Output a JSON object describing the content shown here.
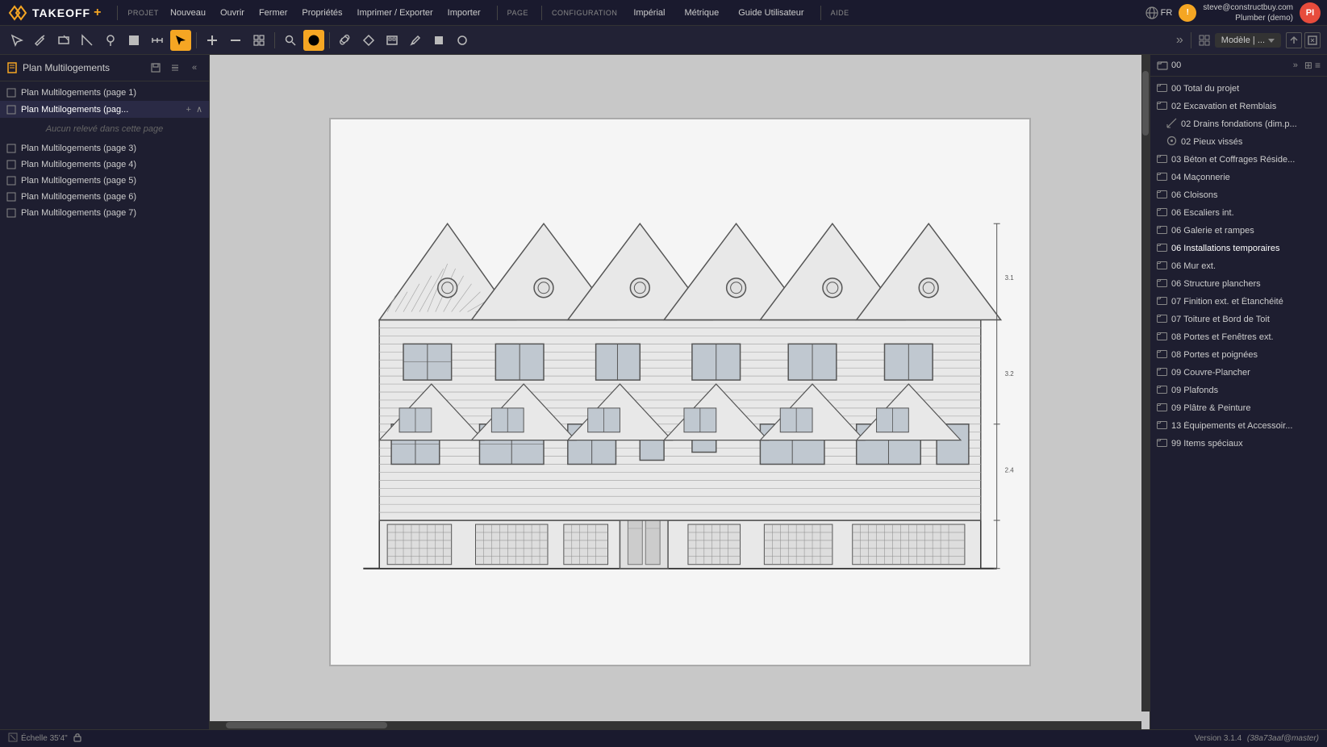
{
  "app": {
    "name": "TAKEOFF+",
    "logo_symbol": "◇◇"
  },
  "top_menu": {
    "projet_label": "PROJET",
    "page_label": "PAGE",
    "configuration_label": "CONFIGURATION",
    "aide_label": "AIDE",
    "items_projet": [
      "Nouveau",
      "Ouvrir",
      "Fermer",
      "Propriétés",
      "Imprimer / Exporter",
      "Importer"
    ],
    "items_configuration": [
      "Impérial",
      "Métrique",
      "Guide Utilisateur"
    ]
  },
  "user": {
    "email": "steve@constructbuy.com",
    "role": "Plumber (demo)",
    "avatar_initials": "PI",
    "lang": "FR"
  },
  "toolbar": {
    "tools": [
      {
        "name": "select-tool",
        "icon": "⬡",
        "active": false
      },
      {
        "name": "draw-tool",
        "icon": "✏",
        "active": false
      },
      {
        "name": "rectangle-tool",
        "icon": "⬜",
        "active": false
      },
      {
        "name": "angle-tool",
        "icon": "⌐",
        "active": false
      },
      {
        "name": "pin-tool",
        "icon": "◈",
        "active": false
      },
      {
        "name": "fill-tool",
        "icon": "■",
        "active": false
      },
      {
        "name": "measure-tool",
        "icon": "↕",
        "active": false
      },
      {
        "name": "cursor-tool",
        "icon": "↖",
        "active": false
      },
      {
        "name": "add-tool",
        "icon": "+",
        "active": false
      },
      {
        "name": "minus-tool",
        "icon": "−",
        "active": false
      },
      {
        "name": "grid-tool",
        "icon": "⊞",
        "active": false
      },
      {
        "name": "search-tool",
        "icon": "🔍",
        "active": false
      },
      {
        "name": "highlight-tool",
        "icon": "◉",
        "active": true
      },
      {
        "name": "link-tool",
        "icon": "⟡",
        "active": false
      },
      {
        "name": "diamond-tool",
        "icon": "◇",
        "active": false
      },
      {
        "name": "window-tool",
        "icon": "⊡",
        "active": false
      },
      {
        "name": "pen-tool",
        "icon": "✒",
        "active": false
      },
      {
        "name": "square-tool",
        "icon": "◼",
        "active": false
      },
      {
        "name": "circle-tool",
        "icon": "○",
        "active": false
      }
    ],
    "model_label": "Modèle | ..."
  },
  "left_sidebar": {
    "title": "Plan Multilogements",
    "pages": [
      {
        "label": "Plan Multilogements (page 1)",
        "active": false,
        "has_icon": true
      },
      {
        "label": "Plan Multilogements (pag...",
        "active": true,
        "has_icon": true,
        "empty_note": "Aucun relevé dans cette page"
      },
      {
        "label": "Plan Multilogements (page 3)",
        "active": false,
        "has_icon": true
      },
      {
        "label": "Plan Multilogements (page 4)",
        "active": false,
        "has_icon": true
      },
      {
        "label": "Plan Multilogements (page 5)",
        "active": false,
        "has_icon": true
      },
      {
        "label": "Plan Multilogements (page 6)",
        "active": false,
        "has_icon": true
      },
      {
        "label": "Plan Multilogements (page 7)",
        "active": false,
        "has_icon": true
      }
    ]
  },
  "status_bar": {
    "scale": "Échelle 35'4\"",
    "version": "Version 3.1.4",
    "build": "(38a73aaf@master)"
  },
  "right_sidebar": {
    "tree_items": [
      {
        "label": "00 Total du projet",
        "level": 0,
        "icon": "folder",
        "type": "folder"
      },
      {
        "label": "02 Excavation et Remblais",
        "level": 0,
        "icon": "folder",
        "type": "folder"
      },
      {
        "label": "02 Drains fondations (dim.p...",
        "level": 1,
        "icon": "measure",
        "type": "item"
      },
      {
        "label": "02 Pieux vissés",
        "level": 1,
        "icon": "circle",
        "type": "item"
      },
      {
        "label": "03 Béton et Coffrages Réside...",
        "level": 0,
        "icon": "folder",
        "type": "folder"
      },
      {
        "label": "04 Maçonnerie",
        "level": 0,
        "icon": "folder",
        "type": "folder"
      },
      {
        "label": "06 Cloisons",
        "level": 0,
        "icon": "folder",
        "type": "folder"
      },
      {
        "label": "06 Escaliers int.",
        "level": 0,
        "icon": "folder",
        "type": "folder"
      },
      {
        "label": "06 Galerie et rampes",
        "level": 0,
        "icon": "folder",
        "type": "folder"
      },
      {
        "label": "06 Installations temporaires",
        "level": 0,
        "icon": "folder",
        "type": "folder"
      },
      {
        "label": "06 Mur ext.",
        "level": 0,
        "icon": "folder",
        "type": "folder"
      },
      {
        "label": "06 Structure planchers",
        "level": 0,
        "icon": "folder",
        "type": "folder"
      },
      {
        "label": "07 Finition ext. et Étanchéité",
        "level": 0,
        "icon": "folder",
        "type": "folder"
      },
      {
        "label": "07 Toiture et Bord de Toit",
        "level": 0,
        "icon": "folder",
        "type": "folder"
      },
      {
        "label": "08 Portes et Fenêtres ext.",
        "level": 0,
        "icon": "folder",
        "type": "folder"
      },
      {
        "label": "08 Portes et poignées",
        "level": 0,
        "icon": "folder",
        "type": "folder"
      },
      {
        "label": "09 Couvre-Plancher",
        "level": 0,
        "icon": "folder",
        "type": "folder"
      },
      {
        "label": "09 Plafonds",
        "level": 0,
        "icon": "folder",
        "type": "folder"
      },
      {
        "label": "09 Plâtre & Peinture",
        "level": 0,
        "icon": "folder",
        "type": "folder"
      },
      {
        "label": "13 Équipements et Accessoir...",
        "level": 0,
        "icon": "folder",
        "type": "folder"
      },
      {
        "label": "99 Items spéciaux",
        "level": 0,
        "icon": "folder",
        "type": "folder"
      }
    ]
  }
}
